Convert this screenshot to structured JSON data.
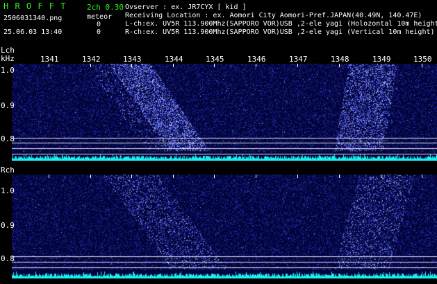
{
  "header": {
    "app_name": "H R O F F T",
    "mode": "2ch 0.30",
    "meteor_label": "meteor",
    "filename": "2506031340.png",
    "datetime": "25.06.03 13:40",
    "meteor_count_l": "0",
    "meteor_count_r": "0",
    "observer": "Ovserver              : ex. JR7CYX [ kid ]",
    "location": "Receiving Location : ex. Aomori City Aomori-Pref.JAPAN(40.49N, 140.47E)",
    "lch_info": "L-ch:ex. UV5R 113.900Mhz(SAPPORO VOR)USB ,2-ele yagi (Holozontal 10m height)",
    "rch_info": "R-ch:ex. UV5R 113.900Mhz(SAPPORO VOR)USB ,2-ele yagi (Vertical 10m height)"
  },
  "colors": {
    "header_green": "#2ef51a",
    "panel_bg": "#02033a",
    "noise": "#3d48ff",
    "signal": "#a8b6ff",
    "trace": "#19f0f0",
    "hline": "#e6e6e6"
  },
  "left_panel": {
    "channel_label": "Lch",
    "unit_label": "kHz",
    "y_ticks": [
      "1.0",
      "0.9",
      "0.8"
    ]
  },
  "right_panel": {
    "channel_label": "Rch",
    "y_ticks": [
      "1.0",
      "0.9",
      "0.8"
    ]
  },
  "time_axis": {
    "labels": [
      "1341",
      "1342",
      "1343",
      "1344",
      "1345",
      "1346",
      "1347",
      "1348",
      "1349",
      "1350"
    ]
  }
}
